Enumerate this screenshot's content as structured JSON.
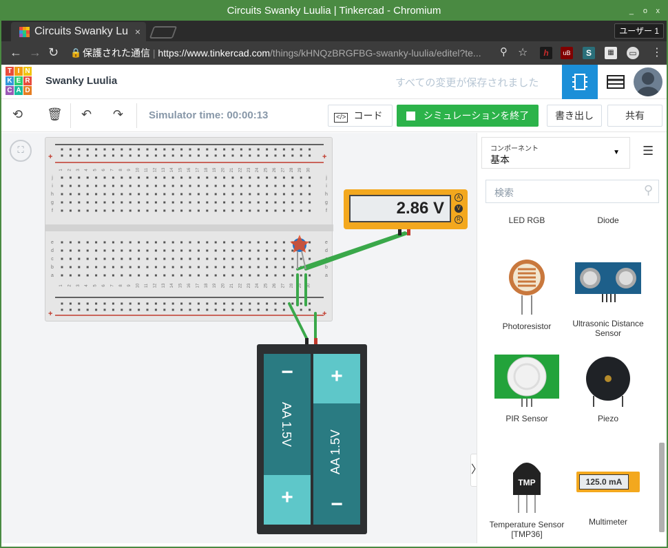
{
  "window": {
    "title": "Circuits Swanky Luulia | Tinkercad - Chromium",
    "controls": [
      "_",
      "o",
      "x"
    ]
  },
  "tabs": [
    {
      "label": "Circuits Swanky Lu",
      "close": "×"
    }
  ],
  "profile_button": "ユーザー 1",
  "address": {
    "security_label": "保護された通信",
    "url_host": "https://www.tinkercad.com",
    "url_path": "/things/kHNQzBRGFBG-swanky-luulia/editel?te..."
  },
  "extensions": [
    {
      "icon": "h-icon",
      "color": "#c42b2b"
    },
    {
      "icon": "ublock-icon",
      "color": "#800000",
      "badge": "2"
    },
    {
      "icon": "s-icon",
      "color": "#2a6f7a"
    },
    {
      "icon": "qr-icon",
      "color": "#555555"
    },
    {
      "icon": "chat-icon",
      "color": "#555555"
    }
  ],
  "app": {
    "logo_letters": [
      "T",
      "I",
      "N",
      "K",
      "E",
      "R",
      "C",
      "A",
      "D"
    ],
    "logo_colors": [
      "#e84c3d",
      "#f39c12",
      "#f1c40f",
      "#3498db",
      "#2ecc71",
      "#e84c3d",
      "#9b59b6",
      "#1abc9c",
      "#e67e22"
    ],
    "project_name": "Swanky Luulia",
    "save_status": "すべての変更が保存されました"
  },
  "toolbar": {
    "sim_time": "Simulator time: 00:00:13",
    "code_label": "コード",
    "stop_sim_label": "シミュレーションを終了",
    "export_label": "書き出し",
    "share_label": "共有"
  },
  "breadboard": {
    "column_numbers": [
      "1",
      "2",
      "3",
      "4",
      "5",
      "6",
      "7",
      "8",
      "9",
      "10",
      "11",
      "12",
      "13",
      "14",
      "15",
      "16",
      "17",
      "18",
      "19",
      "20",
      "21",
      "22",
      "23",
      "24",
      "25",
      "26",
      "27",
      "28",
      "29",
      "30"
    ],
    "top_rows": [
      "j",
      "i",
      "h",
      "g",
      "f"
    ],
    "bottom_rows": [
      "e",
      "d",
      "c",
      "b",
      "a"
    ]
  },
  "multimeter": {
    "reading": "2.86 V",
    "modes": [
      "A",
      "V",
      "R"
    ]
  },
  "battery": {
    "cells": [
      "AA 1.5V",
      "AA 1.5V"
    ],
    "plus": "+",
    "minus": "−"
  },
  "panel": {
    "category_label": "コンポーネント",
    "category_value": "基本",
    "search_placeholder": "検索",
    "components": [
      {
        "name": "LED RGB"
      },
      {
        "name": "Diode"
      },
      {
        "name": "Photoresistor"
      },
      {
        "name": "Ultrasonic Distance Sensor"
      },
      {
        "name": "PIR Sensor"
      },
      {
        "name": "Piezo"
      },
      {
        "name": "Temperature Sensor [TMP36]"
      },
      {
        "name": "Multimeter"
      }
    ],
    "tmp_label": "TMP",
    "multimeter_icon_reading": "125.0 mA"
  }
}
